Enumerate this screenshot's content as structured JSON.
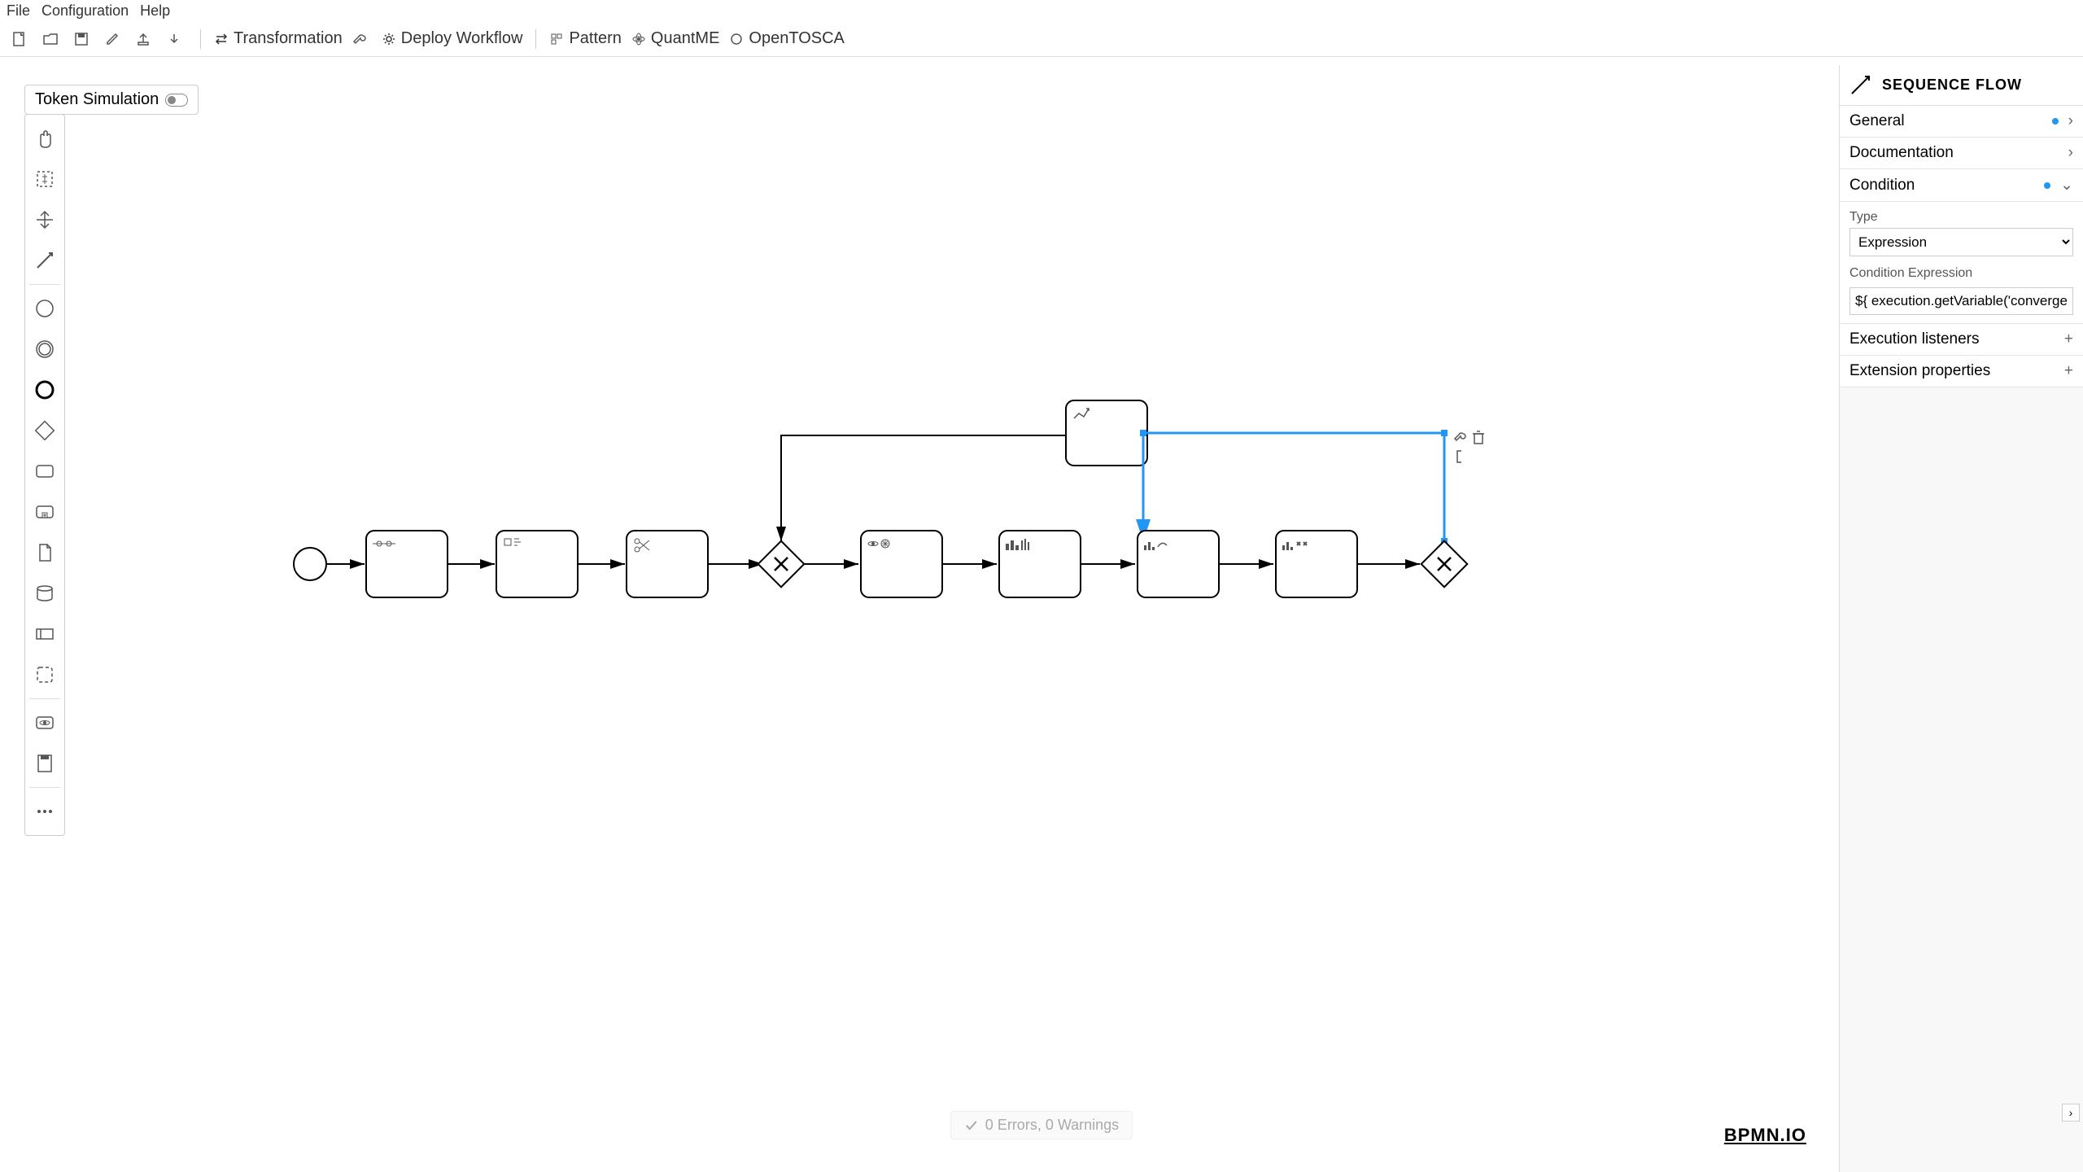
{
  "menubar": {
    "file": "File",
    "configuration": "Configuration",
    "help": "Help"
  },
  "toolbar": {
    "transformation": "Transformation",
    "deploy": "Deploy Workflow",
    "pattern": "Pattern",
    "quantme": "QuantME",
    "opentosca": "OpenTOSCA"
  },
  "token_sim_label": "Token Simulation",
  "props": {
    "header": "SEQUENCE FLOW",
    "general": "General",
    "documentation": "Documentation",
    "condition": "Condition",
    "type_label": "Type",
    "type_value": "Expression",
    "cond_expr_label": "Condition Expression",
    "cond_expr_value": "${ execution.getVariable('converged')==",
    "exec_listeners": "Execution listeners",
    "ext_props": "Extension properties"
  },
  "status": "0 Errors, 0 Warnings",
  "bpmn_logo": "BPMN.IO"
}
